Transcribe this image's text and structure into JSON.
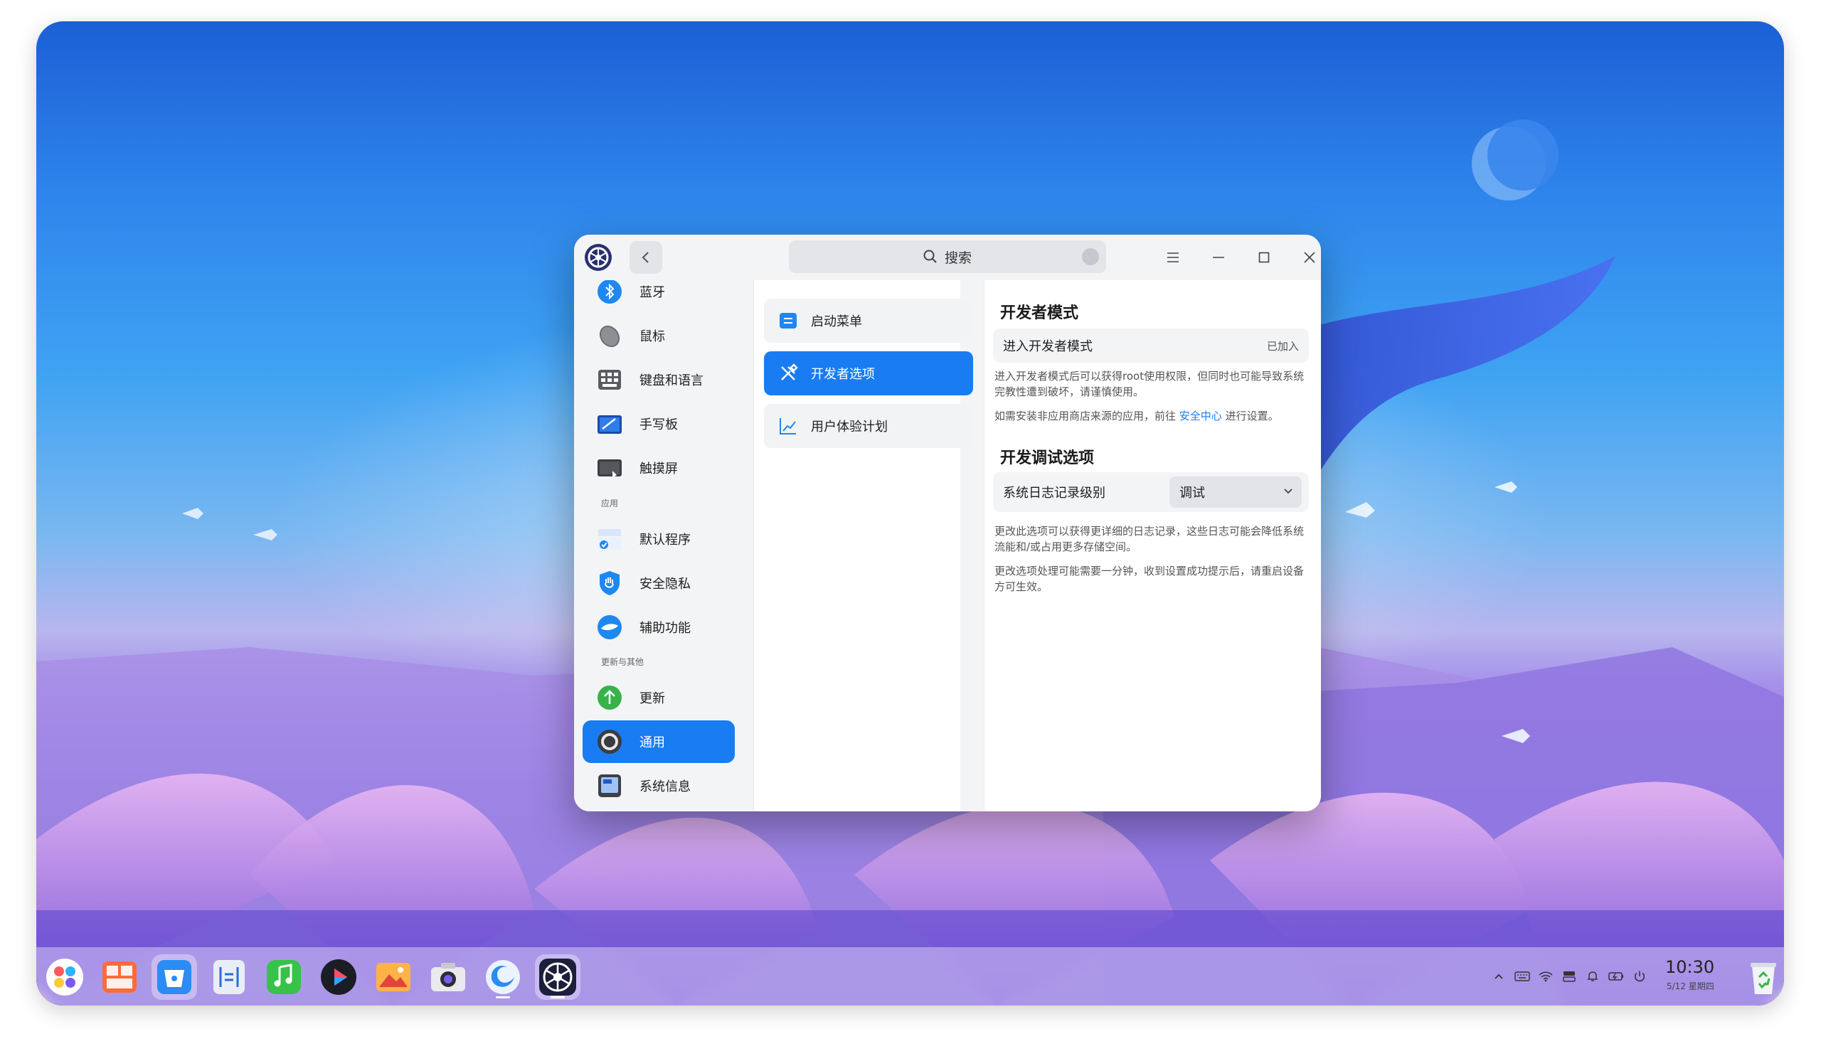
{
  "window": {
    "search_placeholder": "搜索",
    "colors": {
      "accent": "#1a7cf3"
    }
  },
  "sidebar": {
    "items": [
      {
        "label": "蓝牙",
        "icon": "bluetooth-icon"
      },
      {
        "label": "鼠标",
        "icon": "mouse-icon"
      },
      {
        "label": "键盘和语言",
        "icon": "keyboard-icon"
      },
      {
        "label": "手写板",
        "icon": "tablet-icon"
      },
      {
        "label": "触摸屏",
        "icon": "touchscreen-icon"
      },
      {
        "label": "默认程序",
        "icon": "default-apps-icon"
      },
      {
        "label": "安全隐私",
        "icon": "shield-icon"
      },
      {
        "label": "辅助功能",
        "icon": "accessibility-icon"
      },
      {
        "label": "更新",
        "icon": "update-icon"
      },
      {
        "label": "通用",
        "icon": "general-icon",
        "active": true
      },
      {
        "label": "系统信息",
        "icon": "info-icon"
      }
    ],
    "groups": {
      "apps": "应用",
      "update_other": "更新与其他"
    }
  },
  "middle": {
    "items": [
      {
        "label": "启动菜单",
        "icon": "boot-menu-icon"
      },
      {
        "label": "开发者选项",
        "icon": "tools-icon",
        "active": true
      },
      {
        "label": "用户体验计划",
        "icon": "chart-icon"
      }
    ]
  },
  "content": {
    "dev_mode_title": "开发者模式",
    "enter_dev_label": "进入开发者模式",
    "enter_dev_status": "已加入",
    "desc1": "进入开发者模式后可以获得root使用权限，但同时也可能导致系统完教性遭到破坏，请谨慎使用。",
    "desc2_prefix": "如需安装非应用商店来源的应用，前往",
    "desc2_link": "安全中心",
    "desc2_suffix": "进行设置。",
    "debug_title": "开发调试选项",
    "log_level_label": "系统日志记录级别",
    "log_level_value": "调试",
    "desc3": "更改此选项可以获得更详细的日志记录，这些日志可能会降低系统流能和/或占用更多存储空间。",
    "desc4": "更改选项处理可能需要一分钟，收到设置成功提示后，请重启设备方可生效。"
  },
  "dock": {
    "apps": [
      "launcher-icon",
      "multitask-icon",
      "app-store-icon",
      "file-manager-icon",
      "music-icon",
      "video-player-icon",
      "image-viewer-icon",
      "camera-icon",
      "browser-icon",
      "control-center-icon"
    ],
    "clock_time": "10:30",
    "clock_date": "5/12 星期四"
  }
}
